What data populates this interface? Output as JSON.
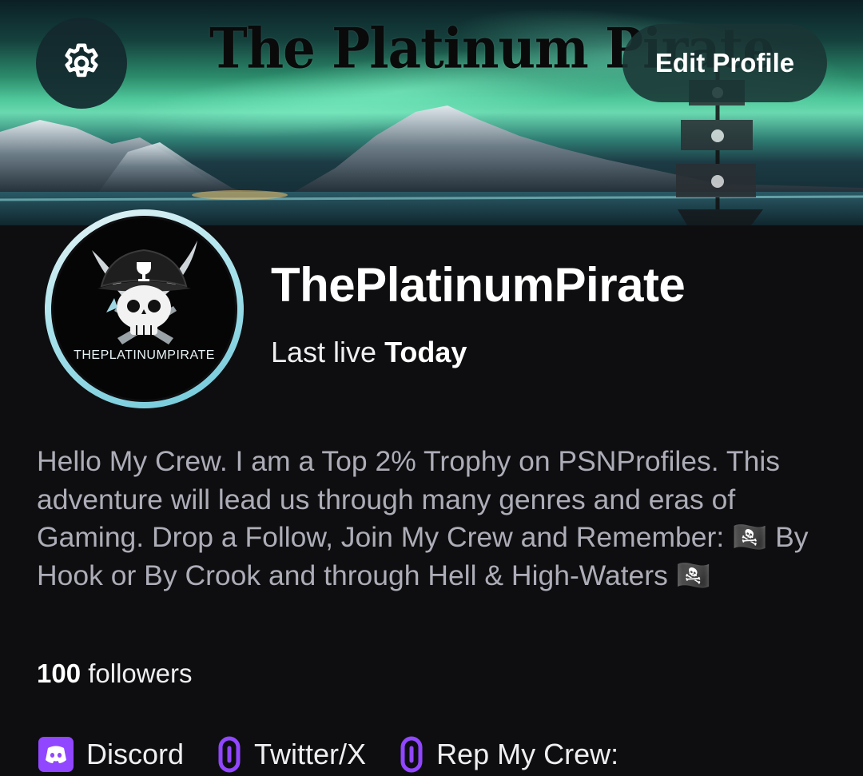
{
  "banner": {
    "title": "The Platinum Pirate",
    "edit_button": "Edit Profile"
  },
  "profile": {
    "avatar_text": "THEPLATINUMPIRATE",
    "display_name": "ThePlatinumPirate",
    "last_live_label": "Last live",
    "last_live_value": "Today",
    "bio": "Hello My Crew. I am a Top 2% Trophy on PSNProfiles. This adventure will lead us through many genres and eras of Gaming. Drop a Follow, Join My Crew and Remember: 🏴‍☠️ By Hook or By Crook and through Hell & High-Waters 🏴‍☠️",
    "followers_count": "100",
    "followers_label": "followers"
  },
  "links": [
    {
      "label": "Discord",
      "icon": "discord-icon"
    },
    {
      "label": "Twitter/X",
      "icon": "link-icon"
    },
    {
      "label": "Rep My Crew:",
      "icon": "link-icon"
    }
  ],
  "colors": {
    "background": "#0e0e10",
    "accent": "#9147ff",
    "muted_text": "#adadb8"
  }
}
